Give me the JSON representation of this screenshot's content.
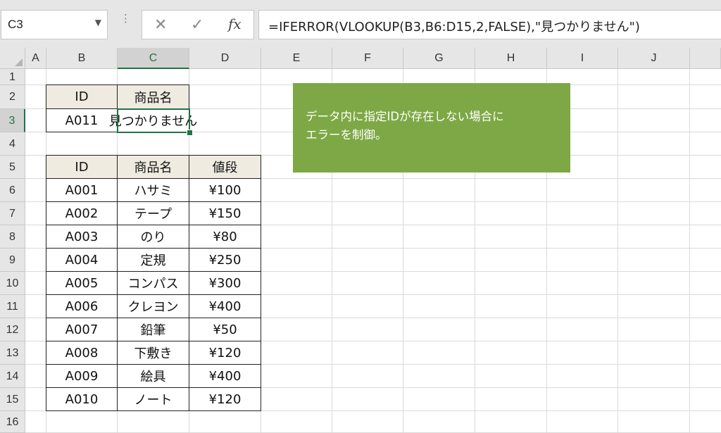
{
  "formula_bar": {
    "name_box": "C3",
    "cancel_icon": "✕",
    "enter_icon": "✓",
    "fx_label": "fx",
    "formula": "=IFERROR(VLOOKUP(B3,B6:D15,2,FALSE),\"見つかりません\")"
  },
  "columns": [
    "A",
    "B",
    "C",
    "D",
    "E",
    "F",
    "G",
    "H",
    "I",
    "J"
  ],
  "rows": [
    "1",
    "2",
    "3",
    "4",
    "5",
    "6",
    "7",
    "8",
    "9",
    "10",
    "11",
    "12",
    "13",
    "14",
    "15",
    "16"
  ],
  "selected_cell": {
    "column": "C",
    "row": "3"
  },
  "lookup_table": {
    "headers": [
      "ID",
      "商品名"
    ],
    "values": [
      "A011",
      "見つかりません"
    ]
  },
  "product_table": {
    "headers": [
      "ID",
      "商品名",
      "値段"
    ],
    "rows": [
      [
        "A001",
        "ハサミ",
        "¥100"
      ],
      [
        "A002",
        "テープ",
        "¥150"
      ],
      [
        "A003",
        "のり",
        "¥80"
      ],
      [
        "A004",
        "定規",
        "¥250"
      ],
      [
        "A005",
        "コンパス",
        "¥300"
      ],
      [
        "A006",
        "クレヨン",
        "¥400"
      ],
      [
        "A007",
        "鉛筆",
        "¥50"
      ],
      [
        "A008",
        "下敷き",
        "¥120"
      ],
      [
        "A009",
        "絵具",
        "¥400"
      ],
      [
        "A010",
        "ノート",
        "¥120"
      ]
    ]
  },
  "callout": {
    "line1": "データ内に指定IDが存在しない場合に",
    "line2": "エラーを制御。"
  },
  "colors": {
    "accent": "#217346",
    "callout": "#7ea845",
    "header_fill": "#efebe1"
  }
}
